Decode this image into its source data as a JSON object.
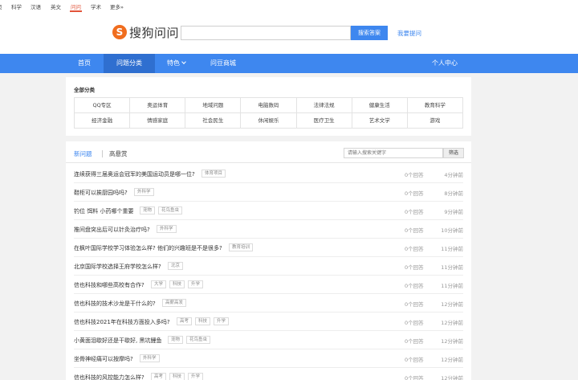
{
  "topnav": {
    "items": [
      "页",
      "科学",
      "汉语",
      "英文",
      "问问",
      "学术",
      "更多»"
    ],
    "active_index": 4
  },
  "header": {
    "logo_mark": "S",
    "logo_text": "搜狗问问",
    "search_value": "",
    "search_button": "搜索答案",
    "ask_link": "我要提问"
  },
  "mainnav": {
    "items": [
      "首页",
      "问题分类",
      "特色",
      "问豆商城"
    ],
    "active_index": 1,
    "user_center": "个人中心"
  },
  "categories": {
    "title": "全部分类",
    "items": [
      "QQ专区",
      "奥运体育",
      "地域问题",
      "电脑数码",
      "法律法规",
      "健康生活",
      "教育科学",
      "经济金融",
      "情感家庭",
      "社会民生",
      "休闲娱乐",
      "医疗卫生",
      "艺术文学",
      "游戏"
    ]
  },
  "questions": {
    "tabs": [
      "新问题",
      "高悬赏"
    ],
    "active_tab": 0,
    "search_placeholder": "请输入搜索关键字",
    "filter_button": "筛选",
    "list": [
      {
        "title": "连续获得三届奥运会冠军的美国运动员是哪一位?",
        "tags": [
          "体育项目"
        ],
        "answers": "0个回答",
        "time": "4分钟前"
      },
      {
        "title": "鞋柜可以挨厨园吗吗?",
        "tags": [
          "外科学"
        ],
        "answers": "0个回答",
        "time": "8分钟前"
      },
      {
        "title": "钓位 饵料 小药哪个重要",
        "tags": [
          "宠物",
          "花鸟鱼虫"
        ],
        "answers": "0个回答",
        "time": "9分钟前"
      },
      {
        "title": "推间盘突出后可以针灸治疗吗?",
        "tags": [
          "外科学"
        ],
        "answers": "0个回答",
        "time": "10分钟前"
      },
      {
        "title": "在枫叶国际学校学习体验怎么样? 他们的兴趣班是不是很多?",
        "tags": [
          "教育培训"
        ],
        "answers": "0个回答",
        "time": "11分钟前"
      },
      {
        "title": "北京国际学校选择王府学校怎么样?",
        "tags": [
          "北京"
        ],
        "answers": "0个回答",
        "time": "11分钟前"
      },
      {
        "title": "信也科技和哪些高校有合作?",
        "tags": [
          "大学",
          "科技",
          "升学"
        ],
        "answers": "0个回答",
        "time": "11分钟前"
      },
      {
        "title": "信也科技的技术沙龙是干什么的?",
        "tags": [
          "高薪高发"
        ],
        "answers": "0个回答",
        "time": "12分钟前"
      },
      {
        "title": "信也科技2021年在科技方面投入多吗?",
        "tags": [
          "高考",
          "科技",
          "升学"
        ],
        "answers": "0个回答",
        "time": "12分钟前"
      },
      {
        "title": "小黄面泪歇好还是干歇好, 黑坑鲤鱼",
        "tags": [
          "宠物",
          "花鸟鱼虫"
        ],
        "answers": "0个回答",
        "time": "12分钟前"
      },
      {
        "title": "坐骨神经痛可以按摩吗?",
        "tags": [
          "外科学"
        ],
        "answers": "0个回答",
        "time": "12分钟前"
      },
      {
        "title": "信也科技的风控能力怎么样?",
        "tags": [
          "高考",
          "科技",
          "升学"
        ],
        "answers": "0个回答",
        "time": "12分钟前"
      }
    ]
  }
}
